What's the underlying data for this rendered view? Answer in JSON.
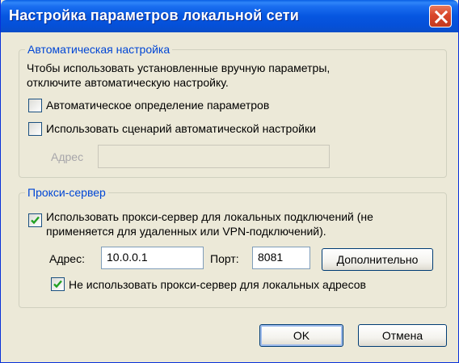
{
  "window": {
    "title": "Настройка параметров локальной сети"
  },
  "auto_config": {
    "legend": "Автоматическая настройка",
    "description_line1": "Чтобы использовать установленные вручную параметры,",
    "description_line2": "отключите автоматическую настройку.",
    "auto_detect_label": "Автоматическое определение параметров",
    "auto_detect_checked": false,
    "use_script_label": "Использовать сценарий автоматической настройки",
    "use_script_checked": false,
    "address_label": "Адрес",
    "address_value": ""
  },
  "proxy": {
    "legend": "Прокси-сервер",
    "use_proxy_label_line1": "Использовать прокси-сервер для локальных подключений (не",
    "use_proxy_label_line2": "применяется для удаленных или VPN-подключений).",
    "use_proxy_checked": true,
    "address_label": "Адрес:",
    "address_value": "10.0.0.1",
    "port_label": "Порт:",
    "port_value": "8081",
    "advanced_button": "Дополнительно",
    "bypass_label": "Не использовать прокси-сервер для локальных адресов",
    "bypass_checked": true
  },
  "footer": {
    "ok_button": "OK",
    "cancel_button": "Отмена"
  },
  "colors": {
    "titlebar": "#0656e0",
    "dialog_bg": "#ece9d8",
    "legend_text": "#0046d5",
    "checkmark": "#21a121",
    "close_button": "#d9462a"
  },
  "icons": {
    "close": "close-icon",
    "check": "checkmark-icon"
  }
}
